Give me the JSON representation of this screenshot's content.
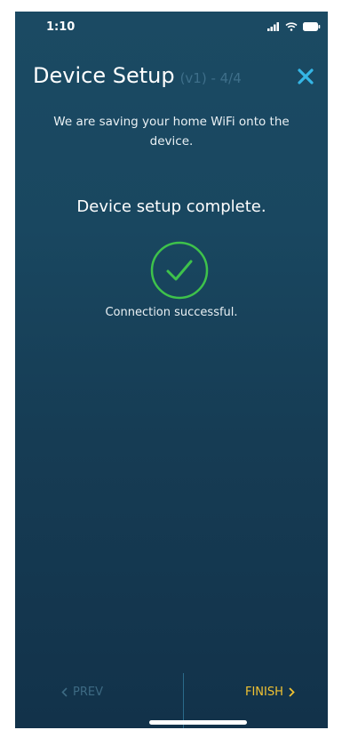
{
  "status_bar": {
    "time": "1:10",
    "icons": [
      "signal-icon",
      "wifi-icon",
      "battery-icon"
    ]
  },
  "header": {
    "title": "Device Setup",
    "step_label": "(v1) - 4/4",
    "close_icon": "close-icon"
  },
  "main": {
    "subtitle": "We are saving your home WiFi onto the device.",
    "status_title": "Device setup complete.",
    "status_icon": "checkmark-icon",
    "status_message": "Connection successful."
  },
  "footer": {
    "prev_label": "PREV",
    "prev_icon": "chevron-left-icon",
    "finish_label": "FINISH",
    "finish_icon": "chevron-right-icon"
  },
  "colors": {
    "background": "#194760",
    "accent_close": "#35b6e6",
    "finish": "#f1c232",
    "success_green": "#3ec24b",
    "disabled": "#3d6a83"
  }
}
